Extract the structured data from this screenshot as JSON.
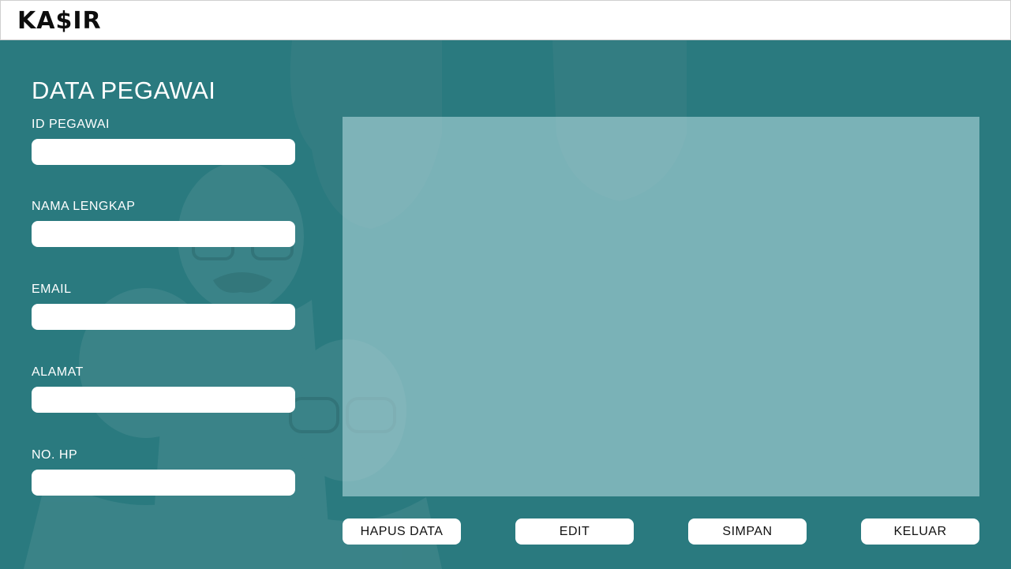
{
  "header": {
    "logo": "KA$IR"
  },
  "form": {
    "title": "DATA PEGAWAI",
    "fields": [
      {
        "label": "ID PEGAWAI",
        "value": "",
        "placeholder": ""
      },
      {
        "label": "NAMA LENGKAP",
        "value": "",
        "placeholder": ""
      },
      {
        "label": "EMAIL",
        "value": "",
        "placeholder": ""
      },
      {
        "label": "ALAMAT",
        "value": "",
        "placeholder": ""
      },
      {
        "label": "NO. HP",
        "value": "",
        "placeholder": ""
      }
    ]
  },
  "actions": {
    "delete_label": "HAPUS DATA",
    "edit_label": "EDIT",
    "save_label": "SIMPAN",
    "exit_label": "KELUAR"
  },
  "colors": {
    "background": "#2a7a7f",
    "panel": "#b0d7dc",
    "header": "#ffffff"
  }
}
